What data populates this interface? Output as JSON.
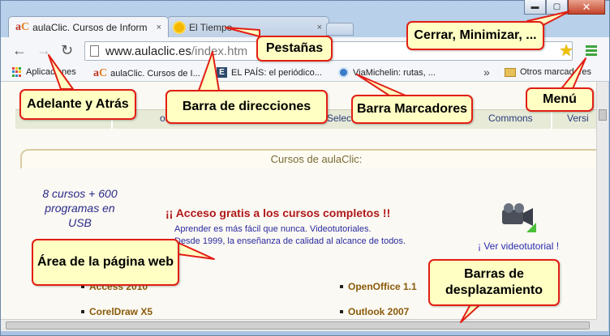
{
  "tabs": [
    {
      "title": "aulaClic. Cursos de Inform",
      "close": "×",
      "favicon": "aC"
    },
    {
      "title": "El Tiempo",
      "close": "×",
      "favicon": "sun-icon"
    }
  ],
  "window_controls": {
    "minimize": "▬",
    "maximize": "▢",
    "close": "✕"
  },
  "toolbar": {
    "back": "←",
    "forward": "→",
    "reload": "↻",
    "url_host": "www.aulaclic.es",
    "url_path": "/index.htm"
  },
  "bookmarks": [
    {
      "label": "Aplicaciones",
      "icon": "apps-icon"
    },
    {
      "label": "aulaClic. Cursos de I...",
      "icon": "aulaclic-favicon"
    },
    {
      "label": "EL PAÍS: el periódico...",
      "icon": "elpais-icon"
    },
    {
      "label": "ViaMichelin: rutas, ...",
      "icon": "viamichelin-icon"
    },
    {
      "label": "Otros marcadores",
      "icon": "folder-icon"
    }
  ],
  "bookmarks_overflow": "»",
  "page": {
    "nav_items": [
      "os",
      "Selecc",
      "Commons",
      "Versi"
    ],
    "section_title": "Cursos de aulaClic:",
    "promo": "8 cursos + 600 programas en USB",
    "headline": "¡¡ Acceso gratis a los cursos completos !!",
    "sub1": "Aprender es más fácil que nunca. Videotutoriales.",
    "sub2": "Desde 1999, la enseñanza de calidad al alcance de todos.",
    "video_link": "¡ Ver videotutorial !",
    "courses": [
      "Access 2010",
      "OpenOffice 1.1",
      "CorelDraw X5",
      "Outlook 2007"
    ]
  },
  "callouts": {
    "tabs": "Pestañas",
    "window": "Cerrar, Minimizar, ...",
    "navigation": "Adelante y Atrás",
    "address_bar": "Barra de direcciones",
    "bookmarks_bar": "Barra Marcadores",
    "menu": "Menú",
    "page_area": "Área de la página web",
    "scrollbars": "Barras de desplazamiento"
  },
  "colors": {
    "callout_fill": "#ffffc4",
    "callout_border": "#e21f14",
    "menu_green": "#3da33d"
  }
}
